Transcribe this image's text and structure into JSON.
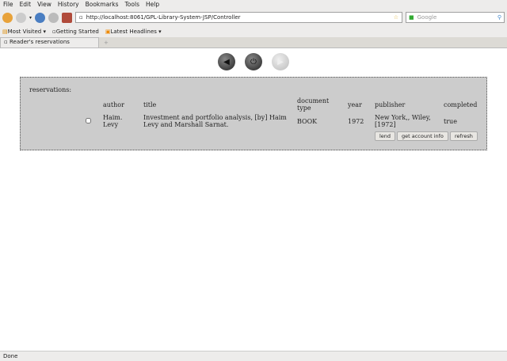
{
  "menu": [
    "File",
    "Edit",
    "View",
    "History",
    "Bookmarks",
    "Tools",
    "Help"
  ],
  "url": "http://localhost:8061/GPL-Library-System-JSP/Controller",
  "search_placeholder": "Google",
  "bookmarks": [
    "Most Visited",
    "Getting Started",
    "Latest Headlines"
  ],
  "tab_title": "Reader's reservations",
  "panel": {
    "label": "reservations:",
    "headers": {
      "author": "author",
      "title": "title",
      "doctype": "document type",
      "year": "year",
      "publisher": "publisher",
      "completed": "completed"
    },
    "row": {
      "author": "Haim. Levy",
      "title": "Investment and portfolio analysis, [by] Haim Levy and Marshall Sarnat.",
      "doctype": "BOOK",
      "year": "1972",
      "publisher": "New York,, Wiley, [1972]",
      "completed": "true"
    },
    "buttons": {
      "lend": "lend",
      "account": "get account info",
      "refresh": "refresh"
    }
  },
  "status": "Done"
}
